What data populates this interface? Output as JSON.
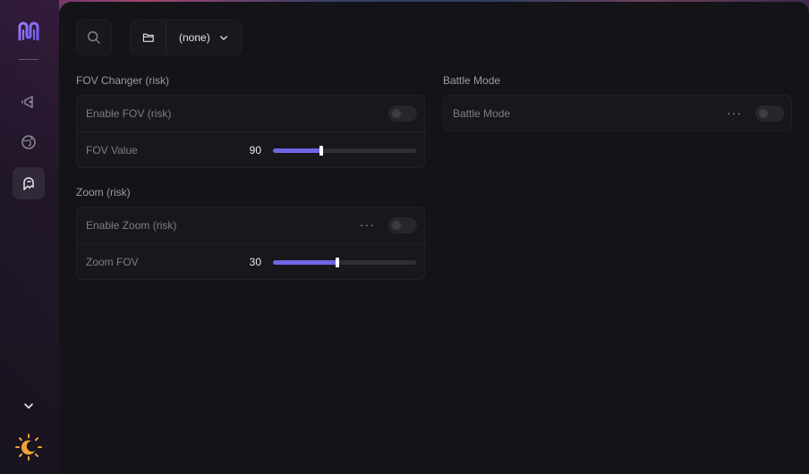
{
  "sidebar": {
    "logo_icon": "m-logo-icon",
    "nav": [
      {
        "icon": "aim-icon"
      },
      {
        "icon": "globe-icon"
      },
      {
        "icon": "ghost-icon",
        "active": true
      }
    ],
    "collapse_icon": "chevron-down-icon",
    "theme_icon": "sun-moon-icon"
  },
  "topbar": {
    "search_icon": "search-icon",
    "folder_icon": "folder-icon",
    "profile_value": "(none)",
    "profile_chevron": "chevron-down-icon"
  },
  "sections": {
    "fov": {
      "title": "FOV Changer (risk)",
      "enable_label": "Enable FOV (risk)",
      "enable_on": false,
      "value_label": "FOV Value",
      "value": "90",
      "value_fraction": 0.34
    },
    "zoom": {
      "title": "Zoom (risk)",
      "enable_label": "Enable Zoom (risk)",
      "enable_on": false,
      "more": "···",
      "value_label": "Zoom FOV",
      "value": "30",
      "value_fraction": 0.45
    },
    "battle": {
      "title": "Battle Mode",
      "toggle_label": "Battle Mode",
      "toggle_on": false,
      "more": "···"
    }
  },
  "colors": {
    "accent": "#6f66e6",
    "panel": "#141418",
    "card": "#18181c"
  }
}
